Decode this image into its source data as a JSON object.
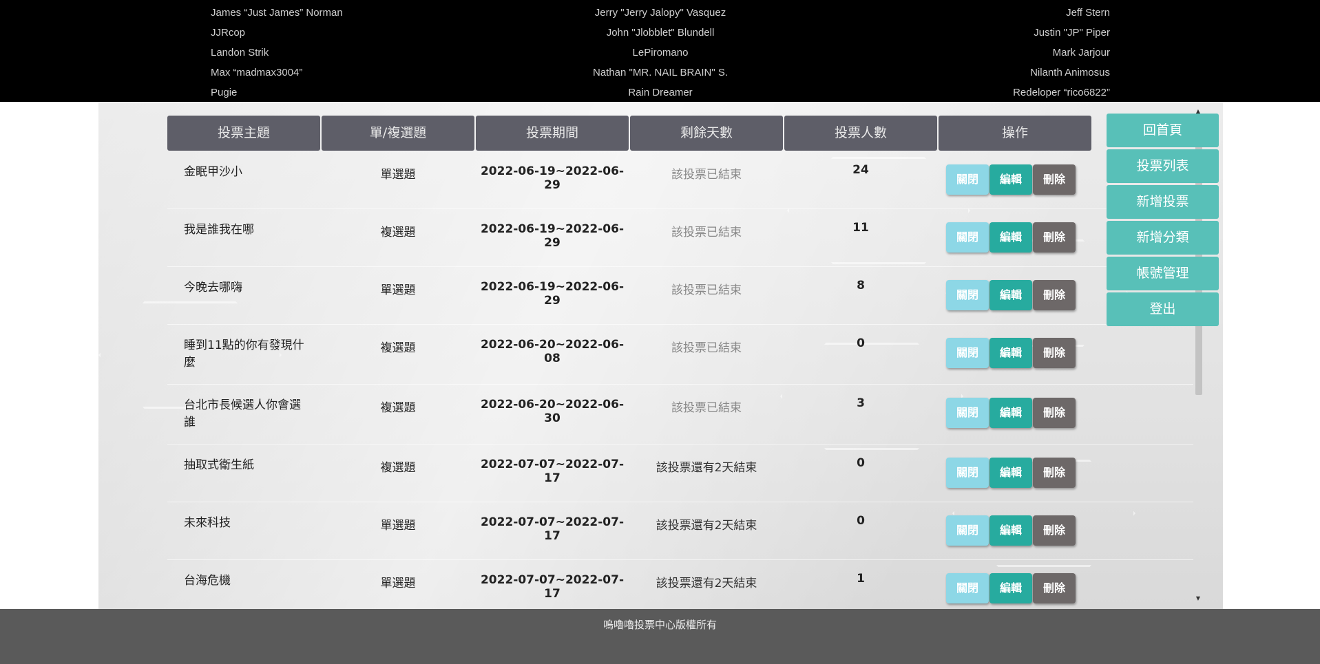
{
  "credits": [
    {
      "left": "James “Just James” Norman",
      "middle": "Jerry \"Jerry Jalopy\" Vasquez",
      "right": "Jeff Stern"
    },
    {
      "left": "JJRcop",
      "middle": "John \"Jlobblet\" Blundell",
      "right": "Justin \"JP\" Piper"
    },
    {
      "left": "Landon Strik",
      "middle": "LePiromano",
      "right": "Mark Jarjour"
    },
    {
      "left": "Max “madmax3004”",
      "middle": "Nathan \"MR. NAIL BRAIN\" S.",
      "right": "Nilanth Animosus"
    },
    {
      "left": "Pugie",
      "middle": "Rain Dreamer",
      "right": "Redeloper “rico6822”"
    }
  ],
  "table": {
    "headers": [
      "投票主題",
      "單/複選題",
      "投票期間",
      "剩餘天數",
      "投票人數",
      "操作"
    ],
    "rows": [
      {
        "title_line1": "金眠甲沙小",
        "title_line2": "",
        "type": "單選題",
        "period_line1": "2022-06-19~2022-06-",
        "period_line2": "29",
        "remaining": "該投票已結束",
        "ended": true,
        "count": "24"
      },
      {
        "title_line1": "我是誰我在哪",
        "title_line2": "",
        "type": "複選題",
        "period_line1": "2022-06-19~2022-06-",
        "period_line2": "29",
        "remaining": "該投票已結束",
        "ended": true,
        "count": "11"
      },
      {
        "title_line1": "今晚去哪嗨",
        "title_line2": "",
        "type": "單選題",
        "period_line1": "2022-06-19~2022-06-",
        "period_line2": "29",
        "remaining": "該投票已結束",
        "ended": true,
        "count": "8"
      },
      {
        "title_line1": "睡到11點的你有發現什",
        "title_line2": "麼",
        "type": "複選題",
        "period_line1": "2022-06-20~2022-06-",
        "period_line2": "08",
        "remaining": "該投票已結束",
        "ended": true,
        "count": "0"
      },
      {
        "title_line1": "台北市長候選人你會選",
        "title_line2": "誰",
        "type": "複選題",
        "period_line1": "2022-06-20~2022-06-",
        "period_line2": "30",
        "remaining": "該投票已結束",
        "ended": true,
        "count": "3"
      },
      {
        "title_line1": "抽取式衛生紙",
        "title_line2": "",
        "type": "複選題",
        "period_line1": "2022-07-07~2022-07-",
        "period_line2": "17",
        "remaining": "該投票還有2天結束",
        "ended": false,
        "count": "0"
      },
      {
        "title_line1": "未來科技",
        "title_line2": "",
        "type": "單選題",
        "period_line1": "2022-07-07~2022-07-",
        "period_line2": "17",
        "remaining": "該投票還有2天結束",
        "ended": false,
        "count": "0"
      },
      {
        "title_line1": "台海危機",
        "title_line2": "",
        "type": "單選題",
        "period_line1": "2022-07-07~2022-07-",
        "period_line2": "17",
        "remaining": "該投票還有2天結束",
        "ended": false,
        "count": "1"
      }
    ],
    "buttons": {
      "close": "關閉",
      "edit": "編輯",
      "delete": "刪除"
    }
  },
  "sidebar": {
    "items": [
      "回首頁",
      "投票列表",
      "新增投票",
      "新增分類",
      "帳號管理",
      "登出"
    ]
  },
  "footer": {
    "text": "嗚嚕嚕投票中心版權所有"
  },
  "colors": {
    "header_bg": "#5e5e68",
    "sidebar_btn": "#58c0b8",
    "close_btn": "#8dd7e6",
    "edit_btn": "#27ab9f",
    "delete_btn": "#6d6868",
    "footer_bg": "#5a5a5a"
  }
}
